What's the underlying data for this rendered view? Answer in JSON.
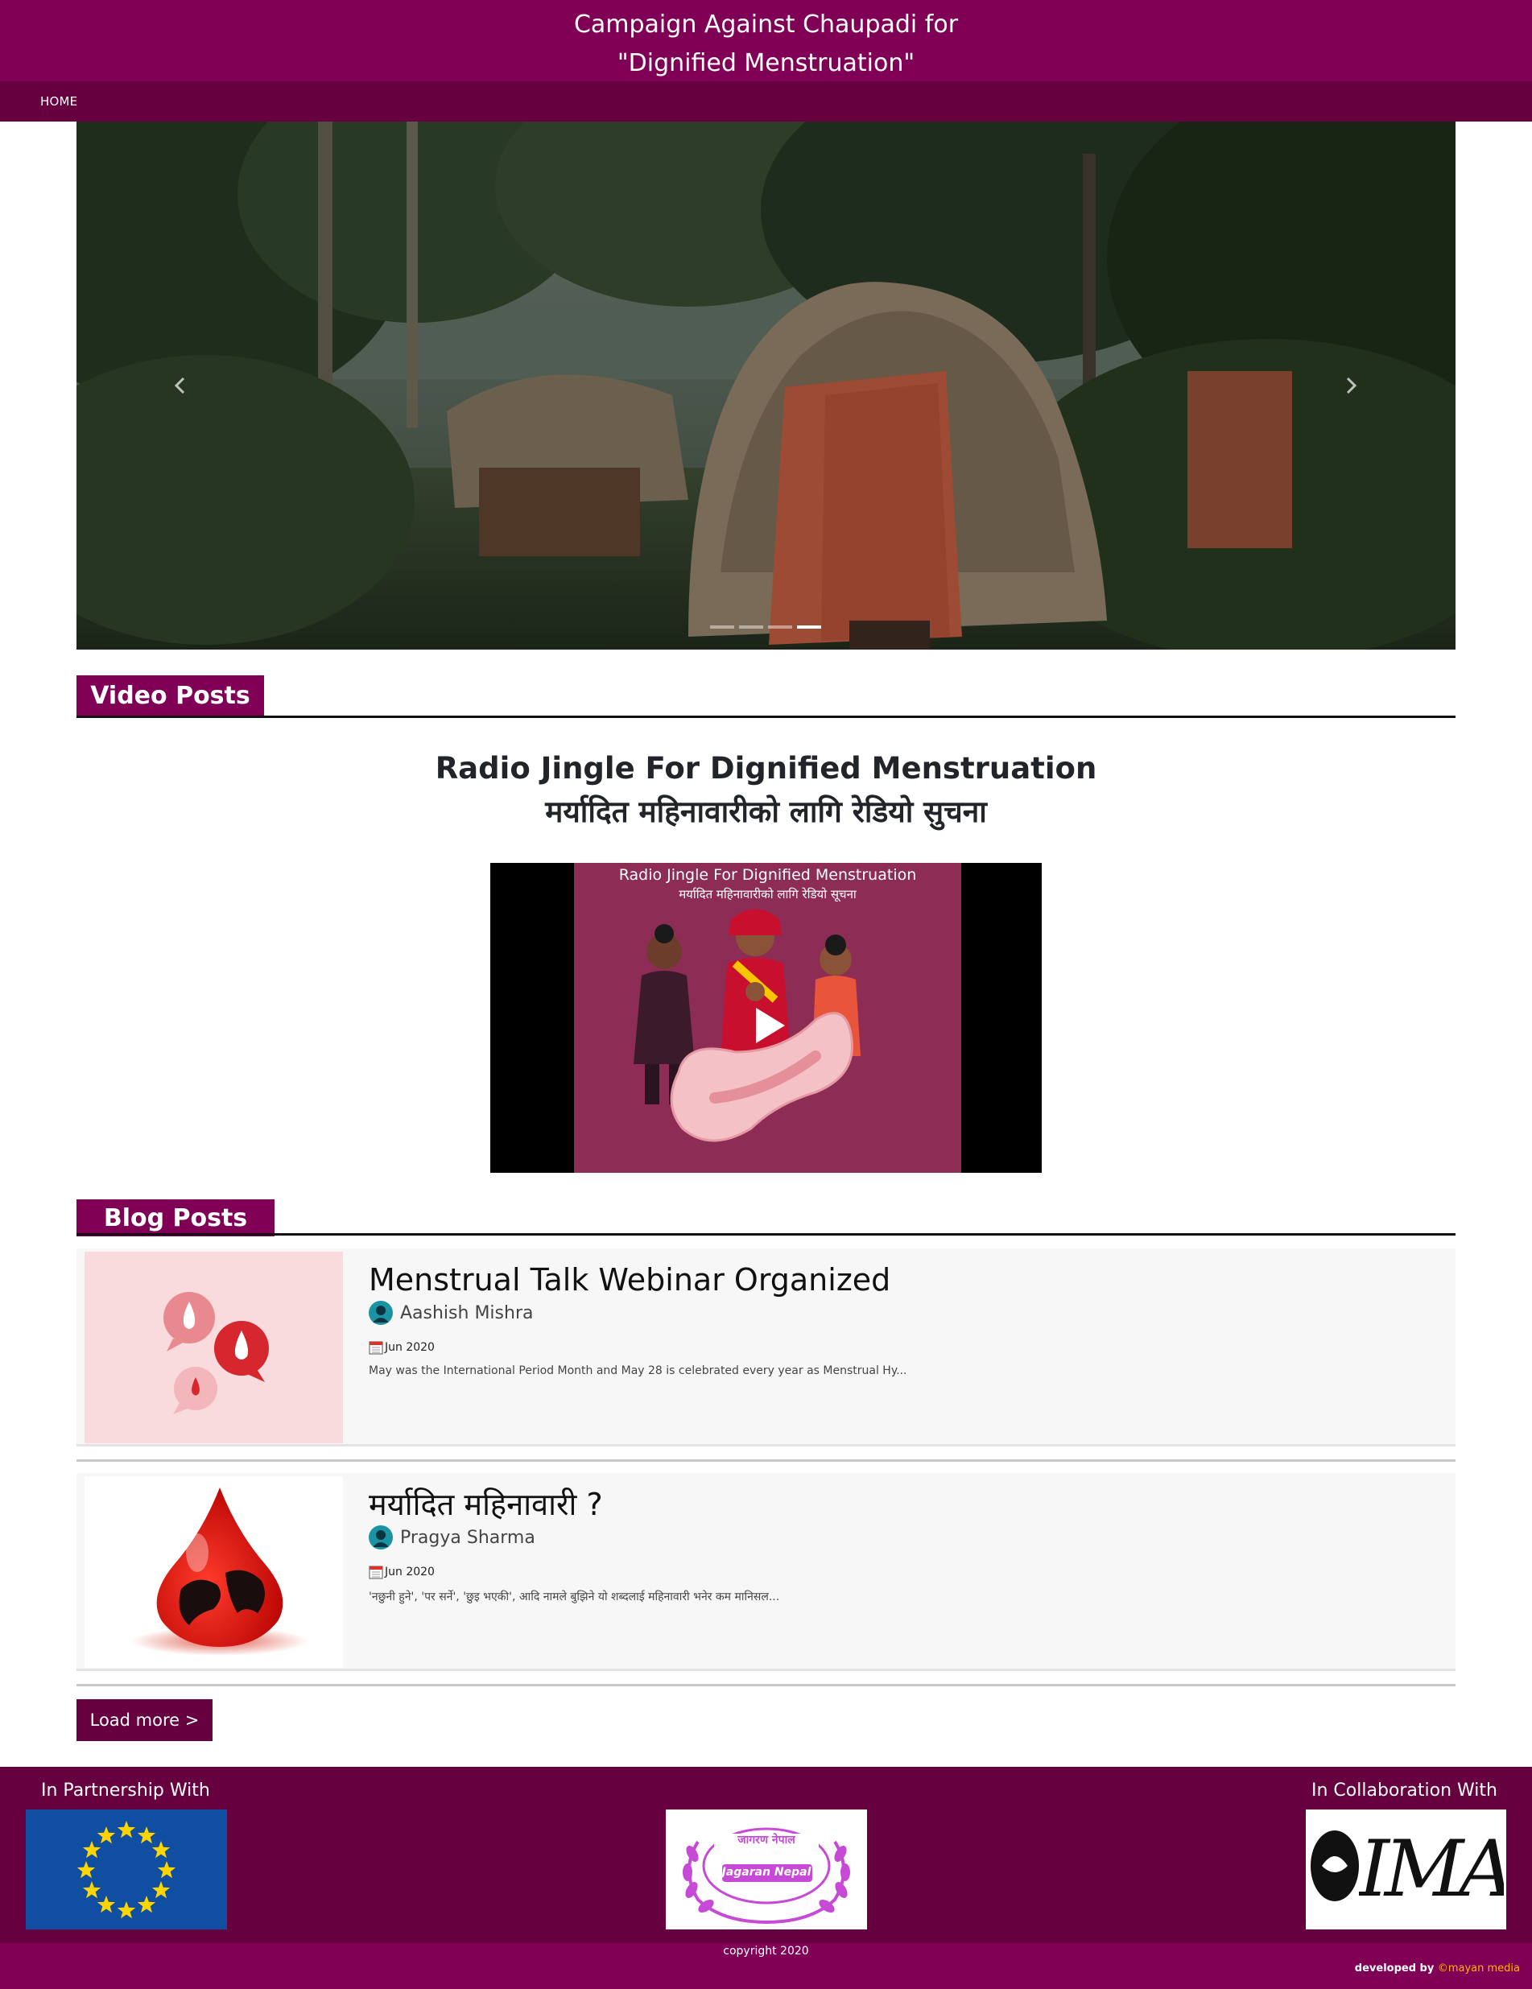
{
  "header": {
    "title_line1": "Campaign Against Chaupadi for",
    "title_line2": "\"Dignified Menstruation\""
  },
  "nav": {
    "home": "HOME"
  },
  "carousel": {
    "indicator_count": 4,
    "active_index": 3,
    "prev_icon": "chevron-left-icon",
    "next_icon": "chevron-right-icon"
  },
  "sections": {
    "video": "Video Posts",
    "blog": "Blog Posts"
  },
  "video": {
    "title_en": "Radio Jingle For Dignified Menstruation",
    "title_ne": "मर्यादित महिनावारीको लागि रेडियो सुचना",
    "thumb_caption_en": "Radio Jingle For Dignified Menstruation",
    "thumb_caption_ne": "मर्यादित महिनावारीको लागि रेडियो सूचना",
    "play_icon": "play-icon"
  },
  "posts": [
    {
      "title": "Menstrual Talk Webinar Organized",
      "author": "Aashish Mishra",
      "date": "Jun 2020",
      "excerpt": "May was the International Period Month and May 28 is celebrated every year as Menstrual Hy..."
    },
    {
      "title": "मर्यादित महिनावारी ?",
      "author": "Pragya Sharma",
      "date": "Jun 2020",
      "excerpt": "'नछुनी हुने', 'पर सर्ने', 'छुइ भएकी', आदि नामले बुझिने यो शब्दलाई महिनावारी भनेर कम मानिसल..."
    }
  ],
  "load_more": "Load more >",
  "footer": {
    "partnership_label": "In Partnership With",
    "collaboration_label": "In Collaboration With",
    "jagaran_logo_text": "Jagaran Nepal",
    "jagaran_logo_devanagari": "जागरण नेपाल",
    "imadr_logo_text": "IMADR",
    "copyright": "copyright 2020",
    "developed_by": "developed by ",
    "developer": "©mayan media"
  },
  "colors": {
    "header_bg": "#800055",
    "nav_bg": "#66003f",
    "footer_bg": "#66003f",
    "developer_link": "#ffb400"
  }
}
